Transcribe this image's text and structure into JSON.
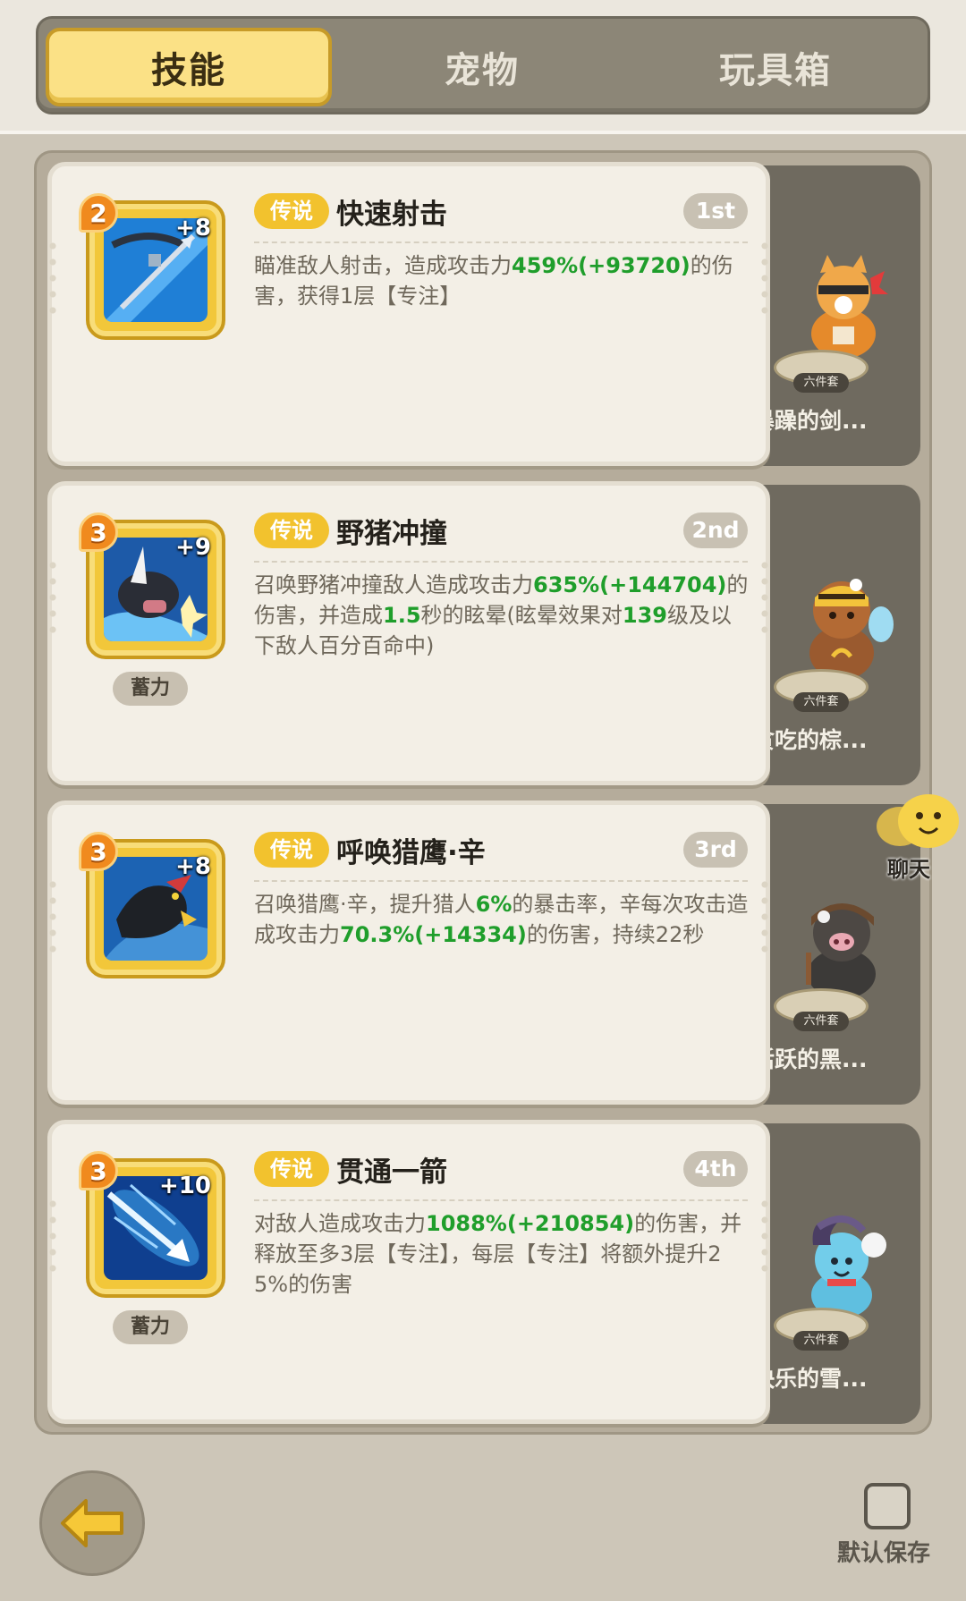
{
  "tabs": [
    {
      "label": "技能",
      "active": true
    },
    {
      "label": "宠物",
      "active": false
    },
    {
      "label": "玩具箱",
      "active": false
    }
  ],
  "skills": [
    {
      "level": "2",
      "plus": "+8",
      "rarity": "传说",
      "name": "快速射击",
      "rank": "1st",
      "charge": "",
      "desc": [
        {
          "t": "瞄准敌人射击，造成攻击力"
        },
        {
          "t": "459%(+93720)",
          "hl": true
        },
        {
          "t": "的伤害，获得1层【专注】"
        }
      ],
      "pet": {
        "name": "暴躁的剑...",
        "set": "六件套"
      }
    },
    {
      "level": "3",
      "plus": "+9",
      "rarity": "传说",
      "name": "野猪冲撞",
      "rank": "2nd",
      "charge": "蓄力",
      "desc": [
        {
          "t": "召唤野猪冲撞敌人造成攻击力"
        },
        {
          "t": "635%(+144704)",
          "hl": true
        },
        {
          "t": "的伤害，并造成"
        },
        {
          "t": "1.5",
          "hl": true
        },
        {
          "t": "秒的眩晕(眩晕效果对"
        },
        {
          "t": "139",
          "hl": true
        },
        {
          "t": "级及以下敌人百分百命中)"
        }
      ],
      "pet": {
        "name": "贪吃的棕...",
        "set": "六件套"
      }
    },
    {
      "level": "3",
      "plus": "+8",
      "rarity": "传说",
      "name": "呼唤猎鹰·辛",
      "rank": "3rd",
      "charge": "",
      "desc": [
        {
          "t": "召唤猎鹰·辛，提升猎人"
        },
        {
          "t": "6%",
          "hl": true
        },
        {
          "t": "的暴击率，辛每次攻击造成攻击力"
        },
        {
          "t": "70.3%(+14334)",
          "hl": true
        },
        {
          "t": "的伤害，持续22秒"
        }
      ],
      "pet": {
        "name": "活跃的黑...",
        "set": "六件套"
      }
    },
    {
      "level": "3",
      "plus": "+10",
      "rarity": "传说",
      "name": "贯通一箭",
      "rank": "4th",
      "charge": "蓄力",
      "desc": [
        {
          "t": "对敌人造成攻击力"
        },
        {
          "t": "1088%(+210854)",
          "hl": true
        },
        {
          "t": "的伤害，并释放至多3层【专注】，每层【专注】将额外提升25%的伤害"
        }
      ],
      "pet": {
        "name": "快乐的雪...",
        "set": "六件套"
      }
    }
  ],
  "chat": {
    "label": "聊天"
  },
  "footer": {
    "save_label": "默认保存"
  }
}
